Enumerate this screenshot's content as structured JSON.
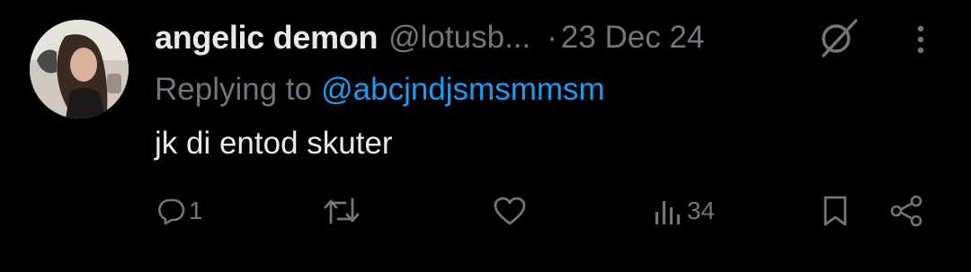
{
  "tweet": {
    "author_name": "angelic demon",
    "handle": "@lotusb...",
    "separator": "·",
    "date": "23 Dec 24",
    "reply_prefix": "Replying to",
    "reply_to": "@abcjndjsmsmmsm",
    "text": "jk di entod skuter"
  },
  "actions": {
    "replies": "1",
    "reposts": "",
    "likes": "",
    "views": "34"
  },
  "icons": {
    "grok": "grok-icon",
    "more": "more-icon",
    "reply": "reply-icon",
    "repost": "repost-icon",
    "like": "heart-icon",
    "views": "views-icon",
    "bookmark": "bookmark-icon",
    "share": "share-icon"
  },
  "colors": {
    "background": "#000000",
    "text": "#e7e9ea",
    "muted": "#71767b",
    "link": "#1d9bf0"
  }
}
